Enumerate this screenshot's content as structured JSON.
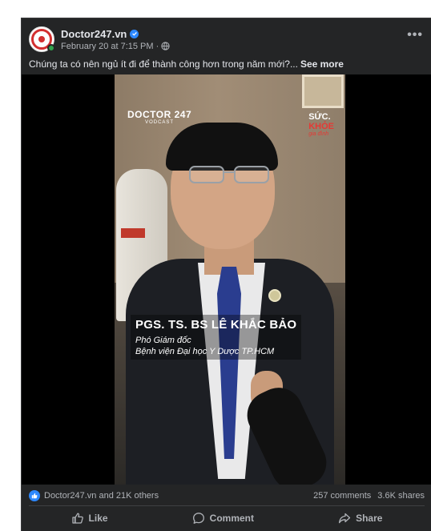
{
  "post": {
    "page_name": "Doctor247.vn",
    "timestamp": "February 20 at 7:15 PM",
    "separator": "·",
    "caption": "Chúng ta có nên ngủ ít đi để thành công hơn trong năm mới?...",
    "see_more": "See more",
    "more_menu": "•••"
  },
  "video": {
    "brand_left_1": "DOCTOR 247",
    "brand_left_2": "VODCAST",
    "brand_right_1": "SỨC.",
    "brand_right_2": "KHỎE",
    "brand_right_3": "gia đình",
    "speaker_name": "PGS. TS. BS LÊ KHẮC BẢO",
    "speaker_title": "Phó Giám đốc",
    "speaker_org": "Bệnh viện Đại học Y Dược TP.HCM"
  },
  "stats": {
    "reactions": "Doctor247.vn and 21K others",
    "comments": "257 comments",
    "shares": "3.6K shares"
  },
  "actions": {
    "like": "Like",
    "comment": "Comment",
    "share": "Share"
  },
  "colors": {
    "card_bg": "#242526",
    "text_primary": "#e4e6eb",
    "text_secondary": "#b0b3b8",
    "accent_blue": "#2d88ff",
    "brand_red": "#d32f2f"
  }
}
